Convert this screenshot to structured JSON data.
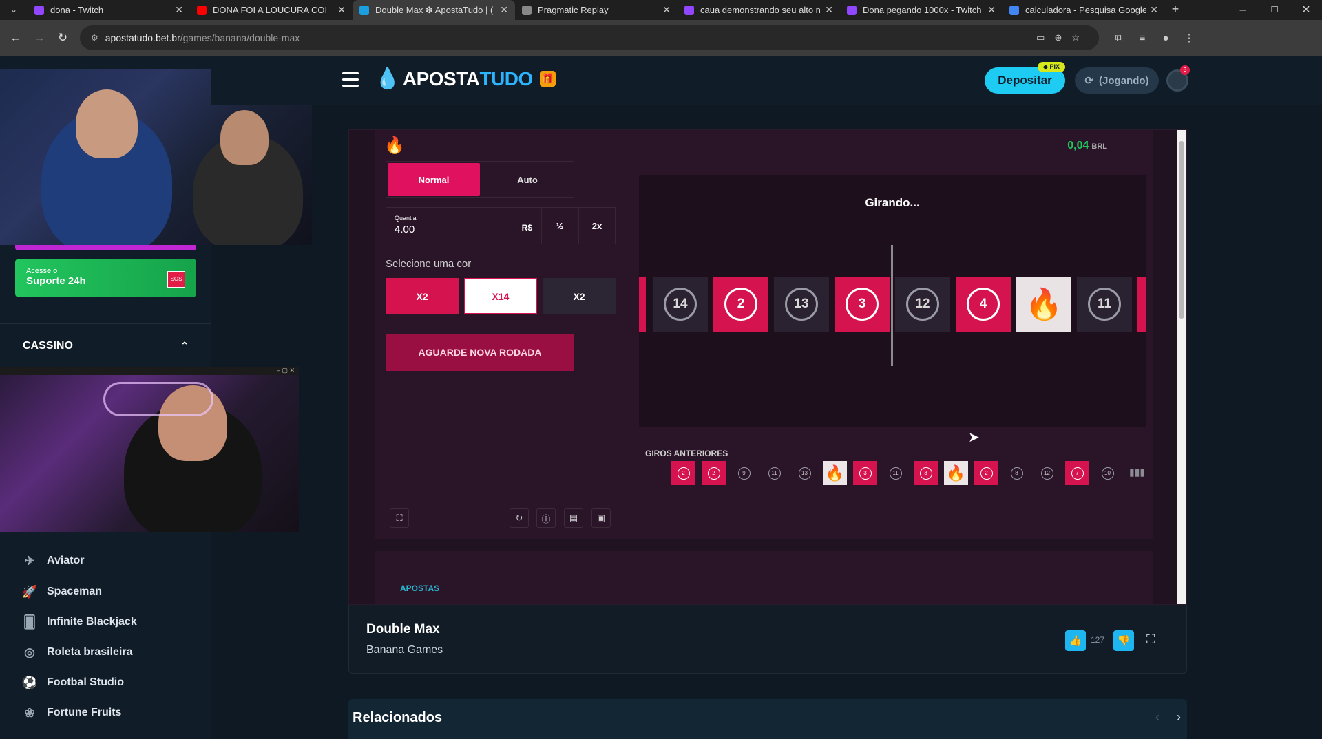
{
  "browser": {
    "tabs": [
      {
        "title": "dona - Twitch",
        "color": "#9146ff"
      },
      {
        "title": "DONA FOI A LOUCURA COI",
        "color": "#ff0000"
      },
      {
        "title": "Double Max ❇ ApostaTudo | (",
        "color": "#1a9fe0"
      },
      {
        "title": "Pragmatic Replay",
        "color": "#888888"
      },
      {
        "title": "caua demonstrando seu alto ni",
        "color": "#9146ff"
      },
      {
        "title": "Dona pegando 1000x - Twitch",
        "color": "#9146ff"
      },
      {
        "title": "calculadora - Pesquisa Google",
        "color": "#4285f4"
      }
    ],
    "url_host": "apostatudo.bet.br",
    "url_path": "/games/banana/double-max"
  },
  "sidebar": {
    "support_small": "Acesse o",
    "support_big": "Suporte 24h",
    "support_badge": "SOS",
    "section": "CASSINO",
    "games": [
      {
        "label": "Aviator",
        "icon": "plane-icon"
      },
      {
        "label": "Spaceman",
        "icon": "rocket-icon"
      },
      {
        "label": "Infinite Blackjack",
        "icon": "card-icon"
      },
      {
        "label": "Roleta brasileira",
        "icon": "roulette-icon"
      },
      {
        "label": "Footbal Studio",
        "icon": "football-icon"
      },
      {
        "label": "Fortune Fruits",
        "icon": "fruit-icon"
      }
    ]
  },
  "header": {
    "logo_part1": "APOSTA",
    "logo_part2": "TUDO",
    "deposit_label": "Depositar",
    "pix_badge": "◆ PIX",
    "playing_label": "(Jogando)",
    "notification_count": "3"
  },
  "game": {
    "balance": "0,04",
    "currency": "BRL",
    "modes": [
      "Normal",
      "Auto"
    ],
    "amount_label": "Quantia",
    "amount_value": "4.00",
    "amount_currency": "R$",
    "half_label": "½",
    "double_label": "2x",
    "pick_label": "Selecione uma cor",
    "colors": [
      {
        "label": "X2",
        "style": "red"
      },
      {
        "label": "X14",
        "style": "white"
      },
      {
        "label": "X2",
        "style": "dark"
      }
    ],
    "wait_button": "AGUARDE NOVA RODADA",
    "status": "Girando...",
    "wheel_tiles": [
      {
        "n": "",
        "type": "red"
      },
      {
        "n": "14",
        "type": "gray"
      },
      {
        "n": "2",
        "type": "red"
      },
      {
        "n": "13",
        "type": "gray"
      },
      {
        "n": "3",
        "type": "red"
      },
      {
        "n": "12",
        "type": "gray"
      },
      {
        "n": "4",
        "type": "red"
      },
      {
        "n": "",
        "type": "white"
      },
      {
        "n": "11",
        "type": "gray"
      },
      {
        "n": "",
        "type": "red"
      }
    ],
    "history_label": "GIROS ANTERIORES",
    "history": [
      {
        "n": "2",
        "type": "red"
      },
      {
        "n": "2",
        "type": "red"
      },
      {
        "n": "9",
        "type": "gray"
      },
      {
        "n": "11",
        "type": "gray"
      },
      {
        "n": "13",
        "type": "gray"
      },
      {
        "n": "",
        "type": "white"
      },
      {
        "n": "3",
        "type": "red"
      },
      {
        "n": "11",
        "type": "gray"
      },
      {
        "n": "3",
        "type": "red"
      },
      {
        "n": "",
        "type": "white"
      },
      {
        "n": "2",
        "type": "red"
      },
      {
        "n": "8",
        "type": "gray"
      },
      {
        "n": "12",
        "type": "gray"
      },
      {
        "n": "7",
        "type": "red"
      },
      {
        "n": "10",
        "type": "gray"
      }
    ],
    "bets_label": "APOSTAS"
  },
  "game_info": {
    "title": "Double Max",
    "provider": "Banana Games",
    "likes": "127"
  },
  "related_title": "Relacionados"
}
